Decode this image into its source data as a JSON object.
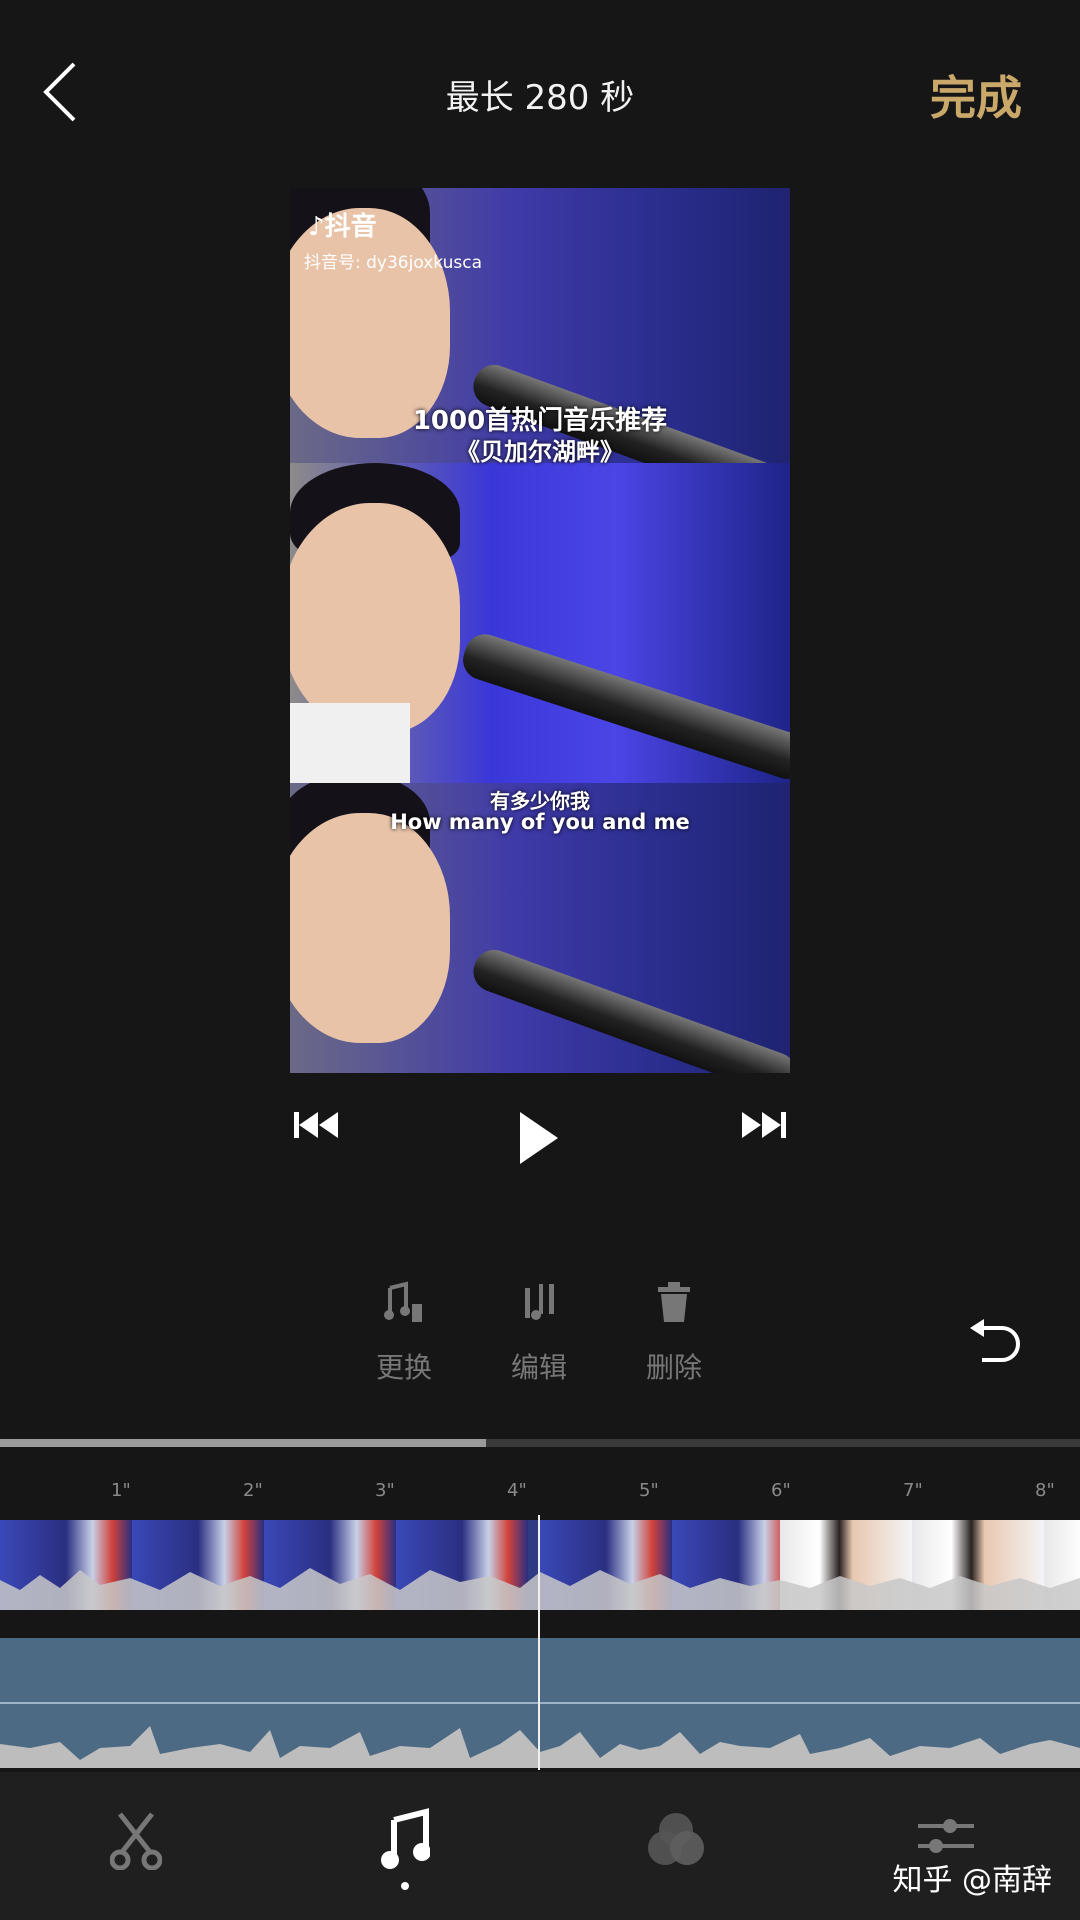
{
  "header": {
    "title": "最长 280 秒",
    "done_label": "完成"
  },
  "preview": {
    "app_name": "抖音",
    "account_id": "抖音号: dy36joxkusca",
    "caption_top_line1": "1000首热门音乐推荐",
    "caption_top_line2": "《贝加尔湖畔》",
    "lyric_cn": "有多少你我",
    "lyric_en": "How many of you and me"
  },
  "tools": [
    {
      "label": "更换",
      "icon": "music-replace-icon"
    },
    {
      "label": "编辑",
      "icon": "music-edit-icon"
    },
    {
      "label": "删除",
      "icon": "trash-icon"
    }
  ],
  "timeline": {
    "ticks": [
      "1\"",
      "2\"",
      "3\"",
      "4\"",
      "5\"",
      "6\"",
      "7\"",
      "8\""
    ],
    "progress": 0.45
  },
  "bottom_nav": [
    {
      "icon": "scissors-icon"
    },
    {
      "icon": "music-note-icon",
      "active": true
    },
    {
      "icon": "filter-circles-icon"
    },
    {
      "icon": "adjust-sliders-icon"
    }
  ],
  "watermark": "知乎 @南辞",
  "colors": {
    "accent": "#c9a86a",
    "background": "#161616",
    "audio_track": "#4d6a84"
  }
}
